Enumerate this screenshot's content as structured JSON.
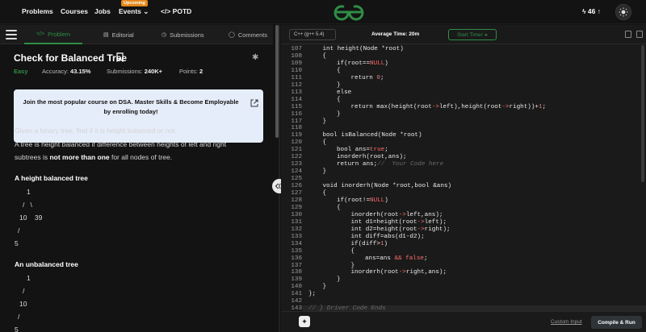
{
  "nav": {
    "items": [
      "Problems",
      "Courses",
      "Jobs",
      "Events",
      "POTD"
    ],
    "events_badge": "Upcoming",
    "streak": "46",
    "logo_icon": "gfg-logo",
    "accent": "#2f8d46"
  },
  "tabs": [
    "Problem",
    "Editorial",
    "Submissions",
    "Comments"
  ],
  "problem": {
    "title": "Check for Balanced Tree",
    "difficulty": "Easy",
    "accuracy_label": "Accuracy:",
    "accuracy": "43.15%",
    "submissions_label": "Submissions:",
    "submissions": "240K+",
    "points_label": "Points:",
    "points": "2",
    "banner": "Join the most popular course on DSA. Master Skills & Become Employable by enrolling today!",
    "desc1": "Given a binary tree, find if it is height balanced or not.",
    "desc2": "A tree is height balanced if difference between heights of left and right",
    "desc3_pre": "subtrees is ",
    "desc3_bold": "not more than one",
    "desc3_post": " for all nodes of tree.",
    "h_balanced": "A height balanced tree",
    "tree1": [
      "1",
      "/   \\",
      "10    39",
      "/",
      "5"
    ],
    "h_unbalanced": "An unbalanced tree",
    "tree2": [
      "1",
      "/",
      "10",
      "/",
      "5"
    ]
  },
  "editor": {
    "language": "C++ (g++ 5.4)",
    "avg_time": "Average Time: 20m",
    "start_timer": "Start Timer",
    "custom_input": "Custom Input",
    "compile_run": "Compile & Run",
    "lines": [
      {
        "n": "107",
        "code": "int height(Node *root)",
        "indent": 1
      },
      {
        "n": "108",
        "code": "{",
        "indent": 1
      },
      {
        "n": "109",
        "code": "if(root==NULL)",
        "indent": 2
      },
      {
        "n": "110",
        "code": "{",
        "indent": 2
      },
      {
        "n": "111",
        "code": "return 0;",
        "indent": 3
      },
      {
        "n": "112",
        "code": "}",
        "indent": 2
      },
      {
        "n": "113",
        "code": "else",
        "indent": 2
      },
      {
        "n": "114",
        "code": "{",
        "indent": 2
      },
      {
        "n": "115",
        "code": "return max(height(root->left),height(root->right))+1;",
        "indent": 3
      },
      {
        "n": "116",
        "code": "}",
        "indent": 2
      },
      {
        "n": "117",
        "code": "}",
        "indent": 1
      },
      {
        "n": "118",
        "code": "",
        "indent": 0
      },
      {
        "n": "119",
        "code": "bool isBalanced(Node *root)",
        "indent": 1
      },
      {
        "n": "120",
        "code": "{",
        "indent": 1
      },
      {
        "n": "121",
        "code": "bool ans=true;",
        "indent": 2
      },
      {
        "n": "122",
        "code": "inorderh(root,ans);",
        "indent": 2
      },
      {
        "n": "123",
        "code": "return ans;//  Your Code here",
        "indent": 2
      },
      {
        "n": "124",
        "code": "}",
        "indent": 1
      },
      {
        "n": "125",
        "code": "",
        "indent": 0
      },
      {
        "n": "126",
        "code": "void inorderh(Node *root,bool &ans)",
        "indent": 1
      },
      {
        "n": "127",
        "code": "{",
        "indent": 1
      },
      {
        "n": "128",
        "code": "if(root!=NULL)",
        "indent": 2
      },
      {
        "n": "129",
        "code": "{",
        "indent": 2
      },
      {
        "n": "130",
        "code": "inorderh(root->left,ans);",
        "indent": 3
      },
      {
        "n": "131",
        "code": "int d1=height(root->left);",
        "indent": 3
      },
      {
        "n": "132",
        "code": "int d2=height(root->right);",
        "indent": 3
      },
      {
        "n": "133",
        "code": "int diff=abs(d1-d2);",
        "indent": 3
      },
      {
        "n": "134",
        "code": "if(diff>1)",
        "indent": 3
      },
      {
        "n": "135",
        "code": "{",
        "indent": 3
      },
      {
        "n": "136",
        "code": "ans=ans && false;",
        "indent": 4
      },
      {
        "n": "137",
        "code": "}",
        "indent": 3
      },
      {
        "n": "138",
        "code": "inorderh(root->right,ans);",
        "indent": 3
      },
      {
        "n": "139",
        "code": "}",
        "indent": 2
      },
      {
        "n": "140",
        "code": "}",
        "indent": 1
      },
      {
        "n": "141",
        "code": "};",
        "indent": 0
      },
      {
        "n": "142",
        "code": "",
        "indent": 0
      },
      {
        "n": "143",
        "code": "// } Driver Code Ends",
        "indent": 0
      }
    ]
  }
}
